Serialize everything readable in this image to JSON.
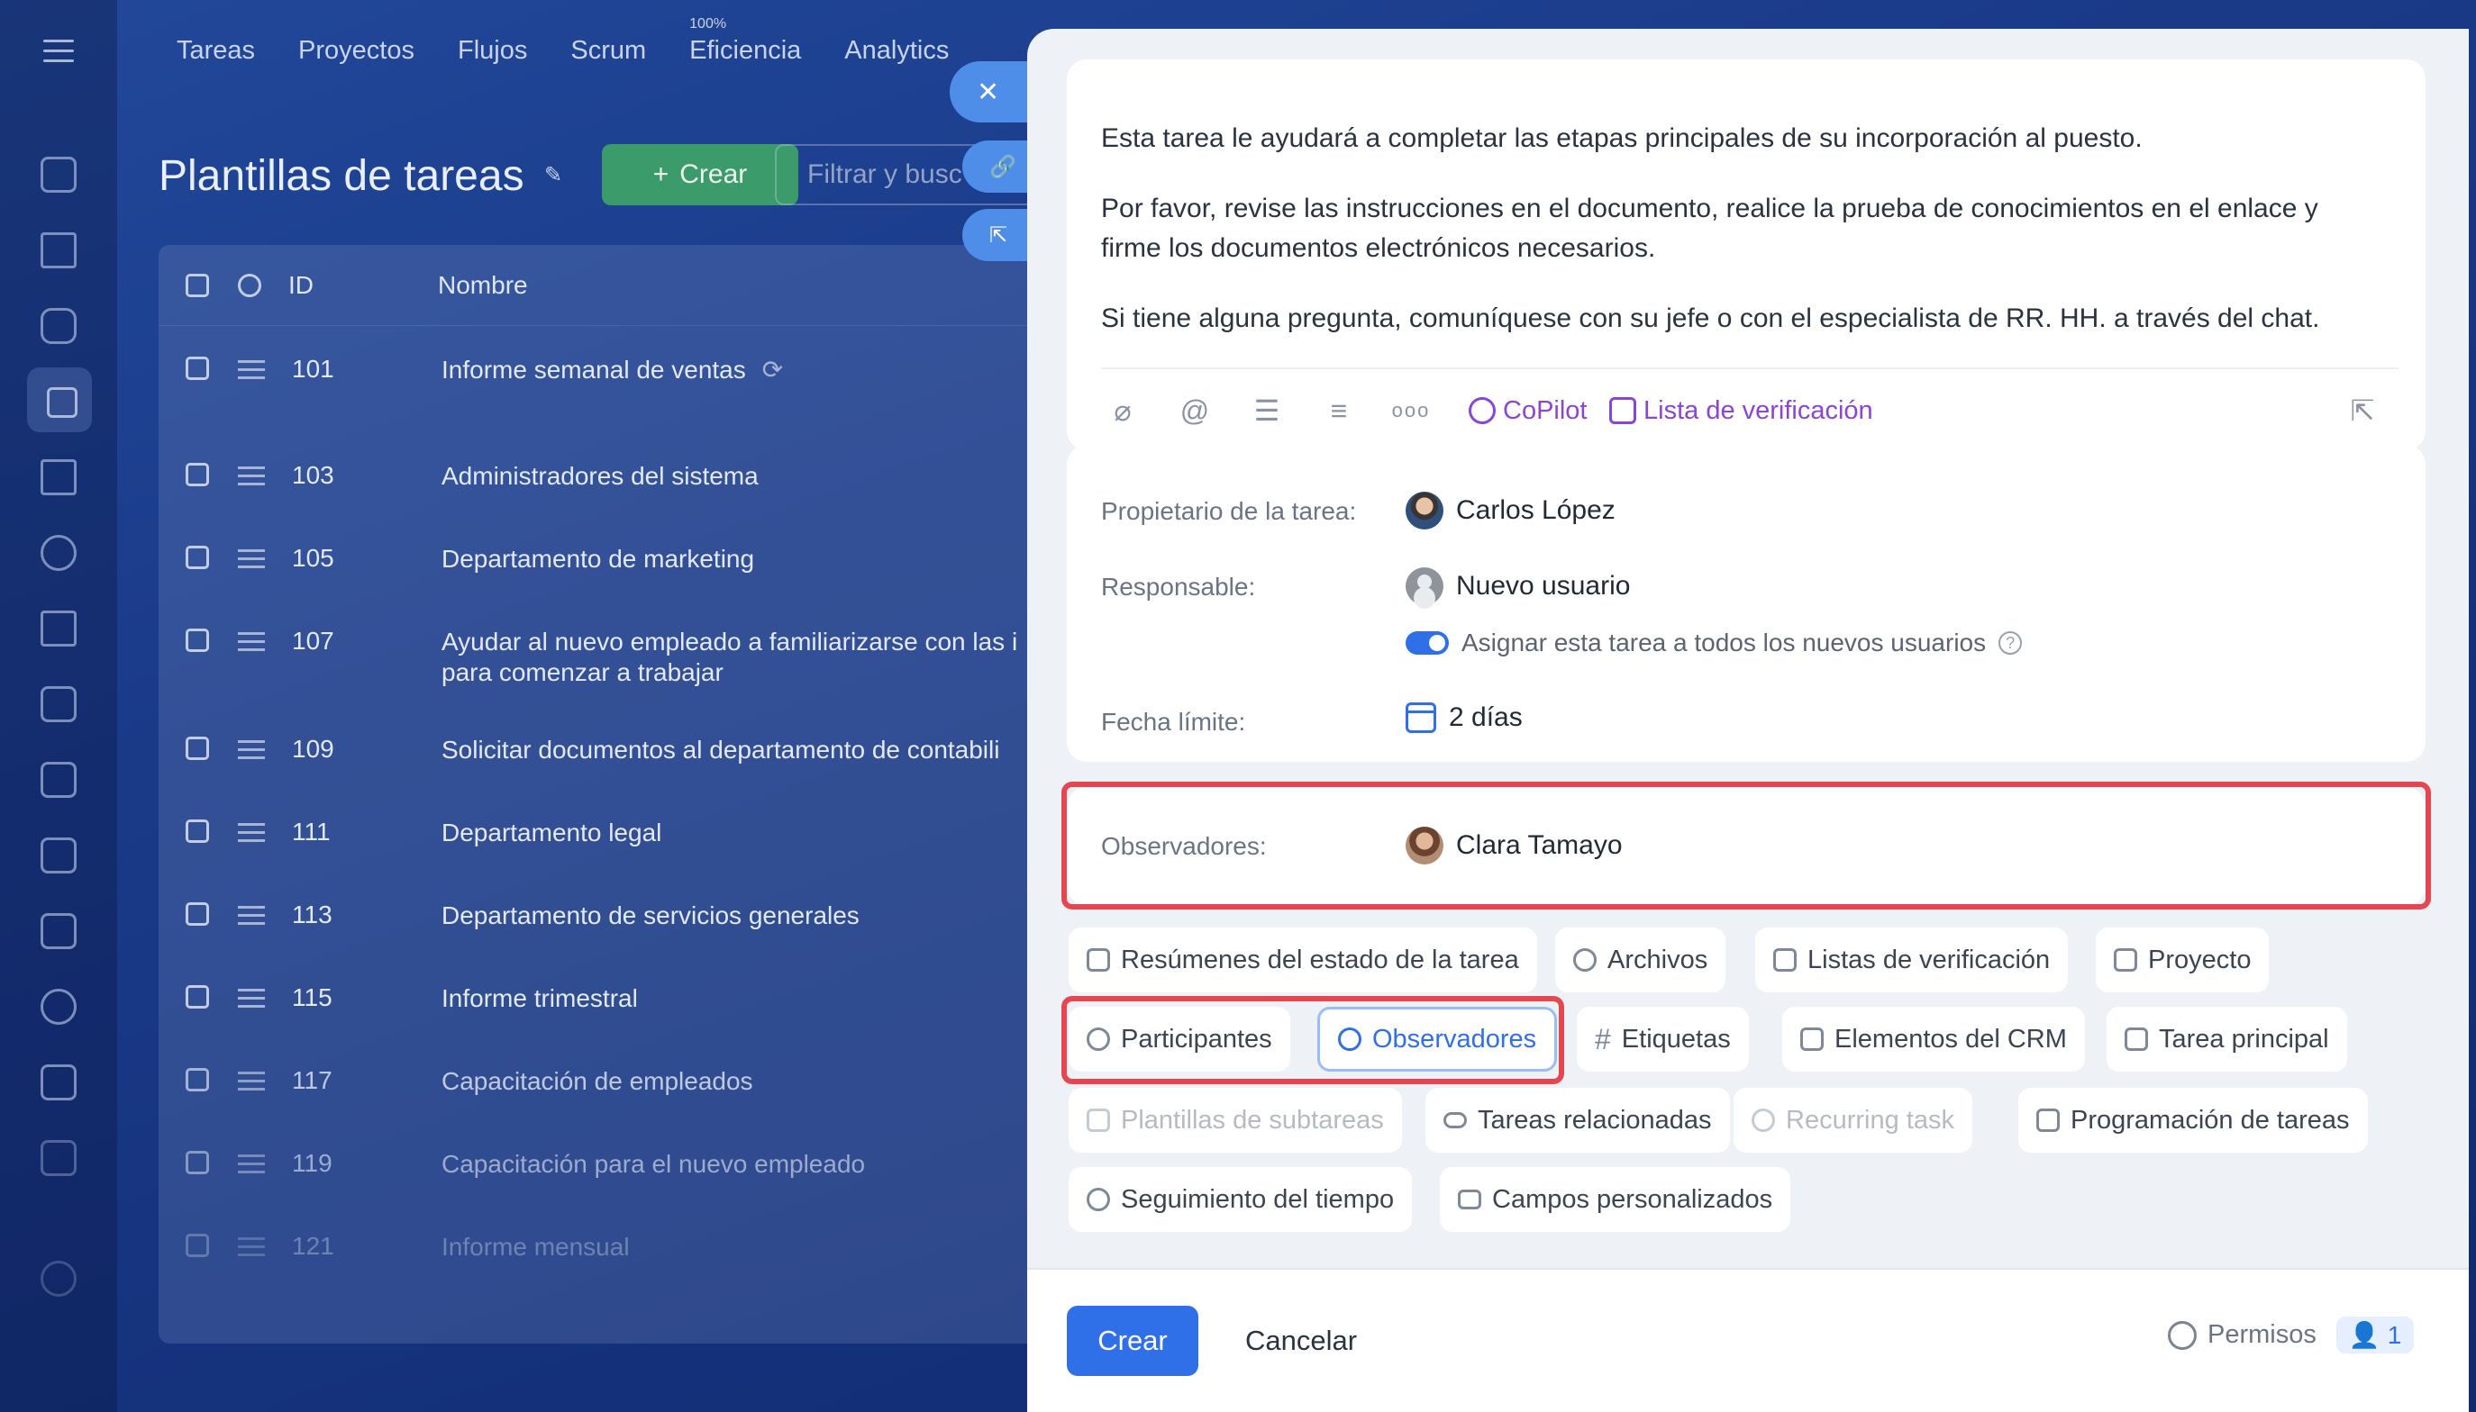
{
  "nav": {
    "items": [
      "Tareas",
      "Proyectos",
      "Flujos",
      "Scrum",
      "Eficiencia",
      "Analytics"
    ],
    "efficiency_badge": "100%"
  },
  "page": {
    "title": "Plantillas de tareas",
    "create_label": "Crear",
    "filter_placeholder": "Filtrar y busc"
  },
  "table": {
    "headers": {
      "id": "ID",
      "name": "Nombre"
    },
    "rows": [
      {
        "id": "101",
        "name": "Informe semanal de ventas"
      },
      {
        "id": "103",
        "name": "Administradores del sistema"
      },
      {
        "id": "105",
        "name": "Departamento de marketing"
      },
      {
        "id": "107",
        "name": "Ayudar al nuevo empleado a familiarizarse con las i",
        "name2": "para comenzar a trabajar"
      },
      {
        "id": "109",
        "name": "Solicitar documentos al departamento de contabili"
      },
      {
        "id": "111",
        "name": "Departamento legal"
      },
      {
        "id": "113",
        "name": "Departamento de servicios generales"
      },
      {
        "id": "115",
        "name": "Informe trimestral"
      },
      {
        "id": "117",
        "name": "Capacitación de empleados"
      },
      {
        "id": "119",
        "name": "Capacitación para el nuevo empleado"
      },
      {
        "id": "121",
        "name": "Informe mensual"
      }
    ]
  },
  "description": {
    "p1": "Esta tarea le ayudará a completar las etapas principales de su incorporación al puesto.",
    "p2": "Por favor, revise las instrucciones en el documento, realice la prueba de conocimientos en el enlace y firme los documentos electrónicos necesarios.",
    "p3": "Si tiene alguna pregunta, comuníquese con su jefe o con el especialista de RR. HH. a través del chat.",
    "copilot": "CoPilot",
    "checklist": "Lista de verificación"
  },
  "fields": {
    "owner_label": "Propietario de la tarea:",
    "owner_value": "Carlos López",
    "responsible_label": "Responsable:",
    "responsible_value": "Nuevo usuario",
    "assign_all_label": "Asignar esta tarea a todos los nuevos usuarios",
    "deadline_label": "Fecha límite:",
    "deadline_value": "2 días",
    "observers_label": "Observadores:",
    "observers_value": "Clara Tamayo"
  },
  "chips": [
    "Resúmenes del estado de la tarea",
    "Archivos",
    "Listas de verificación",
    "Proyecto",
    "Participantes",
    "Observadores",
    "Etiquetas",
    "Elementos del CRM",
    "Tarea principal",
    "Plantillas de subtareas",
    "Tareas relacionadas",
    "Recurring task",
    "Programación de tareas",
    "Seguimiento del tiempo",
    "Campos personalizados"
  ],
  "footer": {
    "create": "Crear",
    "cancel": "Cancelar",
    "permissions": "Permisos",
    "permissions_count": "1"
  },
  "colors": {
    "accent": "#2f6fe8",
    "highlight": "#e4474f",
    "copilot": "#8b45d6"
  }
}
